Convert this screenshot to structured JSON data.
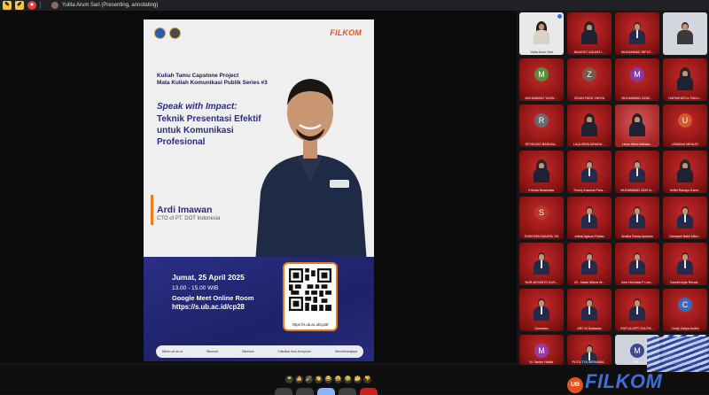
{
  "topbar": {
    "presenter_text": "Yulita Arum Sari (Presenting, annotating)"
  },
  "poster": {
    "brand": "FILKOM",
    "series_line1": "Kuliah Tamu Capstone Project",
    "series_line2": "Mata Kuliah Komunikasi Publik Series #3",
    "headline": "Speak with Impact:",
    "title": "Teknik Presentasi Efektif untuk Komunikasi Profesional",
    "speaker_name": "Ardi Imawan",
    "speaker_role": "CTO of PT. DOT Indonesia",
    "date": "Jumat, 25 April 2025",
    "time": "13.00 - 15.00 WIB",
    "room": "Google Meet Online Room",
    "link": "https://s.ub.ac.id/cp28",
    "qr_caption": "https://s.ub.ac.id/cp28",
    "footer_items": [
      "filkom.ub.ac.id",
      "filkomub",
      "filkomub",
      "Fakultas Ilmu Komputer",
      "filkombrawijaya"
    ]
  },
  "participants": [
    {
      "label": "Yulita Arum Sari",
      "kind": "video-light"
    },
    {
      "label": "BANGKIT AGUNG I...",
      "kind": "hijab"
    },
    {
      "label": "MUHAMMAD RIF'AT...",
      "kind": "man"
    },
    {
      "label": "",
      "kind": "video-light2"
    },
    {
      "label": "MUHAMMAD YASIN ...",
      "kind": "letter",
      "letter": "M",
      "color": "#5b8c3a"
    },
    {
      "label": "ZIDAN FADIL YAHYA",
      "kind": "letter",
      "letter": "Z",
      "color": "#7a5a4a"
    },
    {
      "label": "MUHAMMAD DZAK...",
      "kind": "letter",
      "letter": "M",
      "color": "#8a3aa8"
    },
    {
      "label": "HAFAKHATUL FADLI...",
      "kind": "hijab"
    },
    {
      "label": "REVELINO BARAKA...",
      "kind": "letter",
      "letter": "R",
      "color": "#6a6a6a"
    },
    {
      "label": "LAQUISHA DINARA ...",
      "kind": "hijab"
    },
    {
      "label": "Linda Iffana Mahala...",
      "kind": "hijab-light"
    },
    {
      "label": "USAMAH MIHAJO",
      "kind": "letter",
      "letter": "U",
      "color": "#d05a2a"
    },
    {
      "label": "Erlinda Nutarbatar",
      "kind": "hijab"
    },
    {
      "label": "Thoriq Kusuma Para...",
      "kind": "man"
    },
    {
      "label": "MUHAMMAD ZAKI N...",
      "kind": "man"
    },
    {
      "label": "Seftel Rahayu Kami...",
      "kind": "hijab"
    },
    {
      "label": "SYAKHISH NAUFAL SH",
      "kind": "letter",
      "letter": "S",
      "color": "#b83a2a"
    },
    {
      "label": "Arthai Agisna Firdian",
      "kind": "man"
    },
    {
      "label": "Andika Rama Aprianto",
      "kind": "man"
    },
    {
      "label": "Danapati Nabil Mibo...",
      "kind": "man"
    },
    {
      "label": "NUR ADYANTO KUS...",
      "kind": "man"
    },
    {
      "label": "23 - Made Mitora W...",
      "kind": "man"
    },
    {
      "label": "John Nicholas F Lum...",
      "kind": "man"
    },
    {
      "label": "Gandhi Arjar Rerasi...",
      "kind": "man"
    },
    {
      "label": "Gunawan",
      "kind": "man"
    },
    {
      "label": "ARY AI Dzakwan",
      "kind": "man"
    },
    {
      "label": "RAFI ALUFFI ZULFIK...",
      "kind": "man"
    },
    {
      "label": "Cindy Zahya Andini",
      "kind": "letter",
      "letter": "C",
      "color": "#3a6ab8"
    },
    {
      "label": "M. Tamim Habibi",
      "kind": "letter",
      "letter": "M",
      "color": "#9a3aa8"
    },
    {
      "label": "PUTU TYA WIRNAWA...",
      "kind": "man"
    },
    {
      "label": "RD...",
      "kind": "letter-light",
      "letter": "M",
      "color": "#3a4a8a"
    },
    {
      "label": "",
      "kind": "brand-tile"
    }
  ],
  "reactions": [
    "❤",
    "👍",
    "🎉",
    "👏",
    "😂",
    "😮",
    "😢",
    "🤔",
    "👎"
  ],
  "bottom_brand": {
    "badge": "UB",
    "text": "FILKOM"
  }
}
